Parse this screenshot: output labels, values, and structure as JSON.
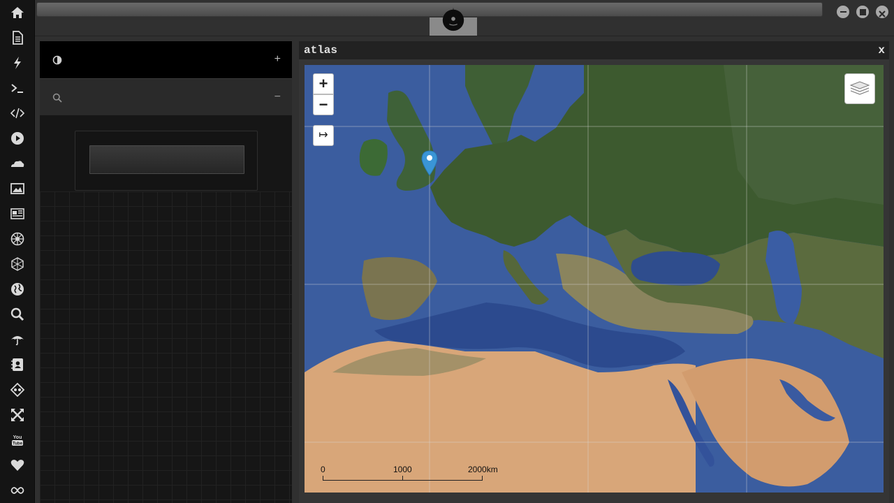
{
  "rail": {
    "icons": [
      "home-icon",
      "document-icon",
      "lightning-icon",
      "terminal-icon",
      "code-icon",
      "play-icon",
      "cloud-icon",
      "image-icon",
      "newspaper-icon",
      "rebel-alliance-icon",
      "empire-icon",
      "globe-icon",
      "search-icon",
      "umbrella-icon",
      "contacts-icon",
      "git-icon",
      "expand-icon",
      "youtube-icon",
      "heart-icon",
      "infinity-icon"
    ]
  },
  "topbar": {
    "search_value": "",
    "logo": "rebel-alliance-logo"
  },
  "window_controls": [
    "minimize-icon",
    "maximize-icon",
    "close-icon"
  ],
  "panel": {
    "head_plus": "+",
    "search_minus": "−",
    "search_value": ""
  },
  "atlas": {
    "title": "atlas",
    "close_label": "x",
    "zoom_in": "+",
    "zoom_out": "−",
    "measure_label": "↦",
    "layers_icon": "layers-icon",
    "scale": {
      "labels": [
        "0",
        "1000",
        "2000km"
      ]
    }
  },
  "colors": {
    "rail_bg": "#141414",
    "panel_bg": "#161616",
    "sea": "#3a5c9e",
    "marker": "#3a95d6"
  }
}
